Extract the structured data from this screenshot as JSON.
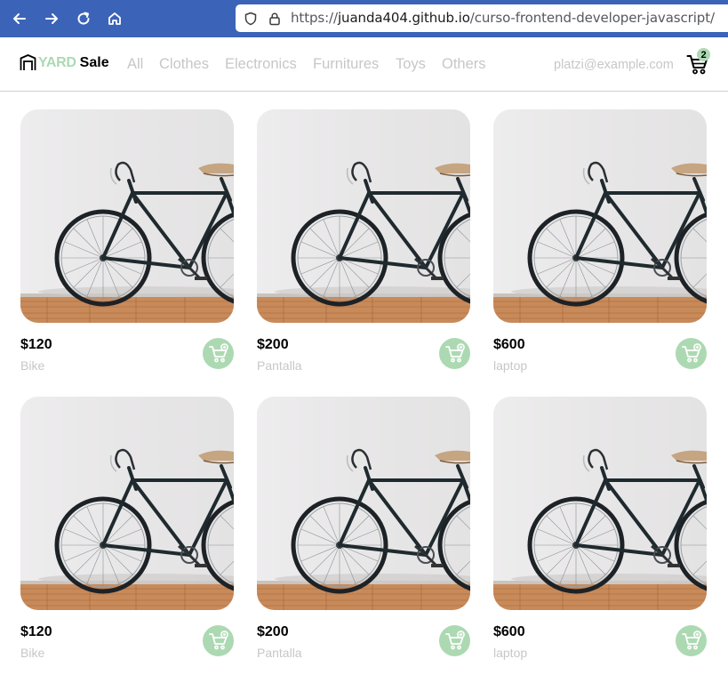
{
  "browser": {
    "url_prefix": "https://",
    "url_host": "juanda404.github.io",
    "url_path": "/curso-frontend-developer-javascript/"
  },
  "nav": {
    "logo_yard": "YARD",
    "logo_sale": "Sale",
    "categories": [
      "All",
      "Clothes",
      "Electronics",
      "Furnitures",
      "Toys",
      "Others"
    ],
    "email": "platzi@example.com",
    "cart_count": "2"
  },
  "products": [
    {
      "price": "$120",
      "name": "Bike"
    },
    {
      "price": "$200",
      "name": "Pantalla"
    },
    {
      "price": "$600",
      "name": "laptop"
    },
    {
      "price": "$120",
      "name": "Bike"
    },
    {
      "price": "$200",
      "name": "Pantalla"
    },
    {
      "price": "$600",
      "name": "laptop"
    }
  ],
  "colors": {
    "browser_bar": "#3b63b8",
    "brand_green": "#acd9b2",
    "muted_text": "#c7c7c7"
  }
}
